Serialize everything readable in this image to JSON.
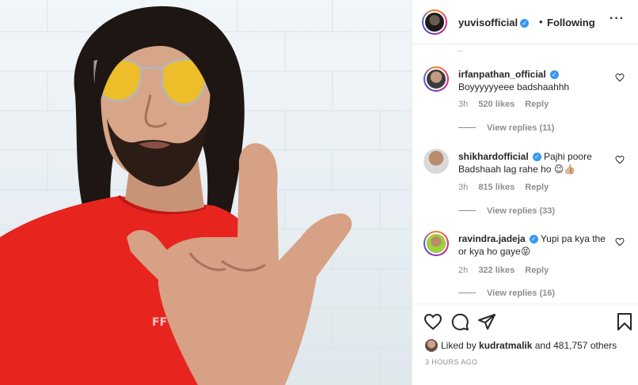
{
  "post": {
    "author": "yuvisofficial",
    "separator": "•",
    "follow_status": "Following",
    "more_icon": "more-horizontal-icon",
    "partial_text": "..."
  },
  "comments": [
    {
      "user": "irfanpathan_official",
      "verified": true,
      "text": "Boyyyyyyeee badshaahhh",
      "time": "3h",
      "likes": "520 likes",
      "reply": "Reply",
      "view_replies": "View replies (11)"
    },
    {
      "user": "shikhardofficial",
      "verified": true,
      "text": "Pajhi poore Badshaah lag rahe ho 😉👍🏼",
      "time": "3h",
      "likes": "815 likes",
      "reply": "Reply",
      "view_replies": "View replies (33)"
    },
    {
      "user": "ravindra.jadeja",
      "verified": true,
      "text": "Yupi pa kya the or kya ho gaye😝",
      "time": "2h",
      "likes": "322 likes",
      "reply": "Reply",
      "view_replies": "View replies (16)"
    }
  ],
  "actions": {
    "like_icon": "heart-icon",
    "comment_icon": "comment-icon",
    "share_icon": "share-icon",
    "save_icon": "bookmark-icon"
  },
  "likes_summary": {
    "prefix": "Liked by",
    "user": "kudratmalik",
    "suffix": "and 481,757 others"
  },
  "timestamp": "3 HOURS AGO",
  "colors": {
    "verified": "#3897f0",
    "text": "#262626",
    "muted": "#8e8e8e",
    "shirt": "#e8241f",
    "glasses": "#f2c21a"
  }
}
